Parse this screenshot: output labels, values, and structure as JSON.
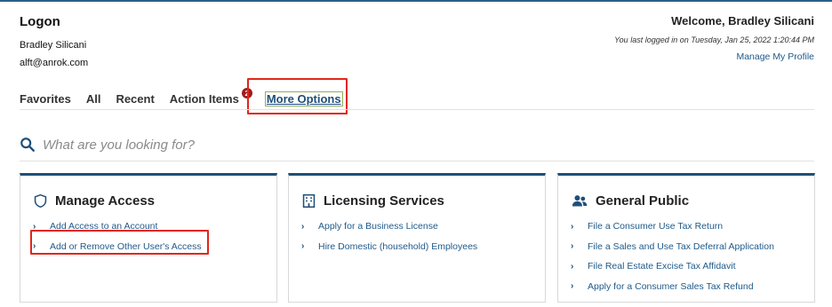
{
  "header": {
    "title": "Logon",
    "user_name": "Bradley Silicani",
    "user_email": "alft@anrok.com",
    "welcome": "Welcome, Bradley Silicani",
    "last_login": "You last logged in on Tuesday, Jan 25, 2022 1:20:44 PM",
    "profile_link": "Manage My Profile"
  },
  "tabs": [
    {
      "label": "Favorites"
    },
    {
      "label": "All"
    },
    {
      "label": "Recent"
    },
    {
      "label": "Action Items",
      "badge": "2"
    },
    {
      "label": "More Options",
      "active": true
    }
  ],
  "search": {
    "placeholder": "What are you looking for?",
    "icon": "search-icon"
  },
  "cards": [
    {
      "title": "Manage Access",
      "icon": "shield-icon",
      "links": [
        "Add Access to an Account",
        "Add or Remove Other User's Access"
      ]
    },
    {
      "title": "Licensing Services",
      "icon": "building-icon",
      "links": [
        "Apply for a Business License",
        "Hire Domestic (household) Employees"
      ]
    },
    {
      "title": "General Public",
      "icon": "people-icon",
      "links": [
        "File a Consumer Use Tax Return",
        "File a Sales and Use Tax Deferral Application",
        "File Real Estate Excise Tax Affidavit",
        "Apply for a Consumer Sales Tax Refund"
      ]
    }
  ],
  "colors": {
    "accent": "#1f4f78",
    "link": "#1f5a8a",
    "highlight": "#e2261a",
    "badge": "#a01c1c"
  }
}
